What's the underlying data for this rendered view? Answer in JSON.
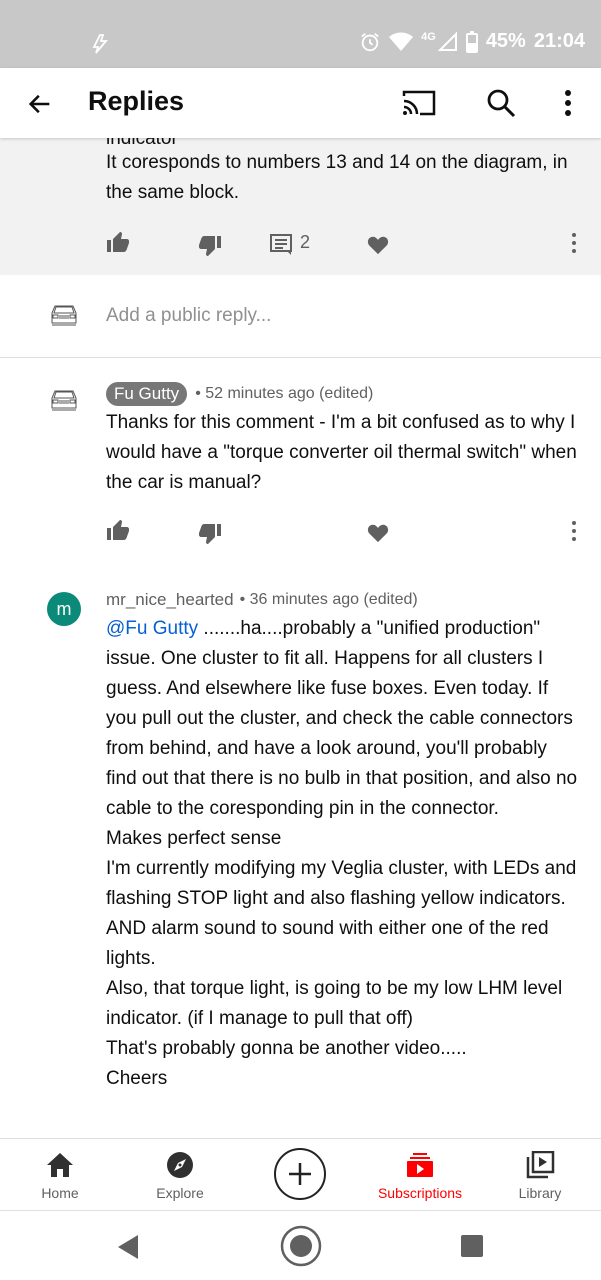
{
  "status_bar": {
    "network": "4G",
    "battery": "45%",
    "time": "21:04"
  },
  "app_bar": {
    "title": "Replies"
  },
  "parent_comment": {
    "cutoff_text": "indicator",
    "text": "It coresponds to numbers 13 and 14 on the diagram, in the same block.",
    "reply_count": "2"
  },
  "add_reply": {
    "placeholder": "Add a public reply..."
  },
  "replies": [
    {
      "author": "Fu Gutty",
      "time": "52 minutes ago (edited)",
      "text": "Thanks for this comment - I'm a bit confused as to why I would have a \"torque converter oil thermal switch\" when the car is manual?"
    },
    {
      "author": "mr_nice_hearted",
      "avatar_letter": "m",
      "time": "36 minutes ago (edited)",
      "mention": "@Fu Gutty",
      "text": " .......ha....probably a \"unified production\" issue. One cluster to fit all. Happens for all clusters I guess. And elsewhere like fuse boxes. Even today. If you pull out the cluster, and check the cable connectors from behind, and have a look around, you'll probably find out that there is no bulb in that position, and also no cable to the coresponding pin in the connector.",
      "lines_after": [
        "Makes perfect sense",
        "I'm currently modifying my Veglia cluster, with LEDs and flashing STOP light and also flashing yellow indicators. AND alarm sound to sound with either one of the red lights.",
        "Also, that torque light, is going to be my low LHM level indicator. (if I manage to pull that off)",
        "That's probably gonna be another video.....",
        "Cheers"
      ]
    }
  ],
  "bottom_nav": {
    "home": "Home",
    "explore": "Explore",
    "subscriptions": "Subscriptions",
    "library": "Library"
  },
  "colors": {
    "accent": "#ff0000",
    "link": "#065fd4",
    "avatar_m": "#0b8a7a"
  }
}
